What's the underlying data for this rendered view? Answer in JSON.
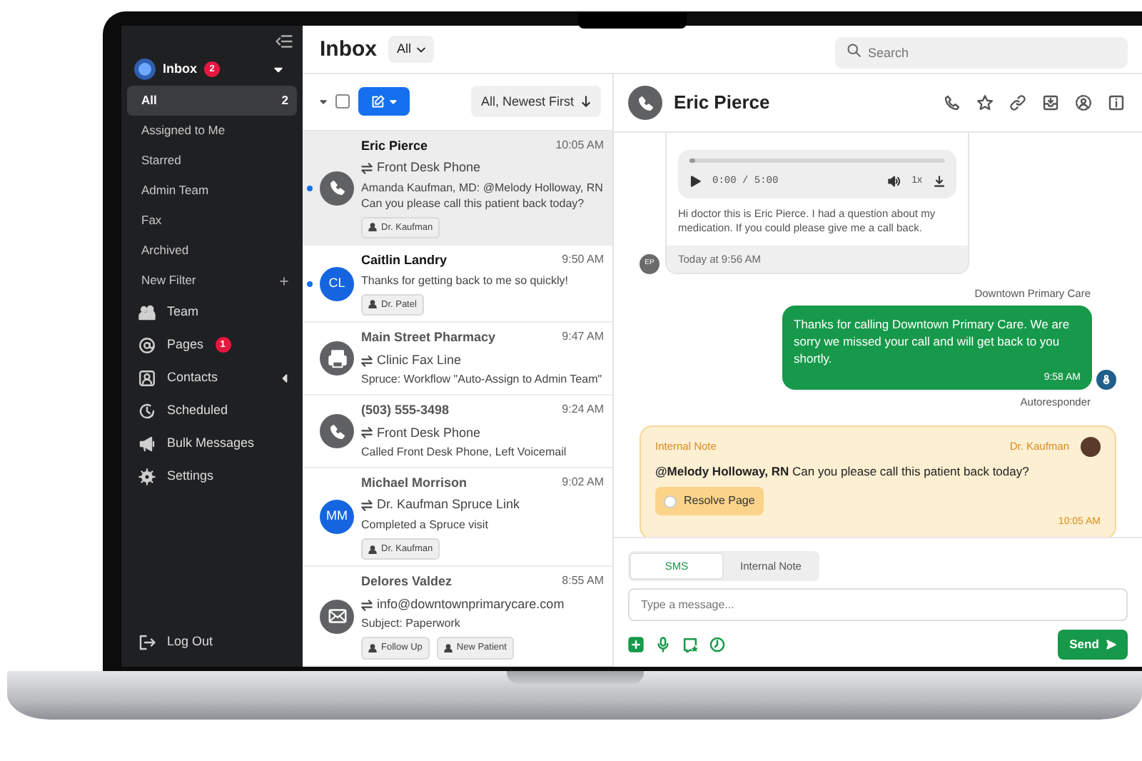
{
  "sidebar": {
    "inbox": {
      "label": "Inbox",
      "badge": "2",
      "expanded": true
    },
    "filters": [
      {
        "label": "All",
        "count": "2",
        "selected": true
      },
      {
        "label": "Assigned to Me",
        "selected": false
      },
      {
        "label": "Starred",
        "selected": false
      },
      {
        "label": "Admin Team",
        "selected": false
      },
      {
        "label": "Fax",
        "selected": false
      },
      {
        "label": "Archived",
        "selected": false
      }
    ],
    "new_filter": "New Filter",
    "nav": [
      {
        "kind": "team",
        "label": "Team"
      },
      {
        "kind": "pages",
        "label": "Pages",
        "badge": "1"
      },
      {
        "kind": "contacts",
        "label": "Contacts",
        "expanded": false
      },
      {
        "kind": "scheduled",
        "label": "Scheduled"
      },
      {
        "kind": "bulk",
        "label": "Bulk Messages"
      },
      {
        "kind": "settings",
        "label": "Settings"
      }
    ],
    "logout": "Log Out"
  },
  "header": {
    "title": "Inbox",
    "filter": "All",
    "search": {
      "placeholder": "Search"
    }
  },
  "list": {
    "select_all": {
      "checked": false
    },
    "sort": "All, Newest First",
    "conversations": [
      {
        "name": "Eric Pierce",
        "time": "10:05 AM",
        "unread": true,
        "selected": true,
        "avatar": {
          "kind": "phone"
        },
        "channel": "Front Desk Phone",
        "preview": "Amanda Kaufman, MD: @Melody Holloway, RN Can you please call this patient back today?",
        "tags": [
          "Dr. Kaufman"
        ]
      },
      {
        "name": "Caitlin Landry",
        "time": "9:50 AM",
        "unread": true,
        "selected": false,
        "avatar": {
          "kind": "initials",
          "initials": "CL"
        },
        "preview": "Thanks for getting back to me so quickly!",
        "tags": [
          "Dr. Patel"
        ]
      },
      {
        "name": "Main Street Pharmacy",
        "time": "9:47 AM",
        "unread": false,
        "selected": false,
        "avatar": {
          "kind": "fax"
        },
        "channel": "Clinic Fax Line",
        "preview": "Spruce: Workflow \"Auto-Assign to Admin Team\""
      },
      {
        "name": "(503) 555-3498",
        "time": "9:24 AM",
        "unread": false,
        "selected": false,
        "avatar": {
          "kind": "phone"
        },
        "channel": "Front Desk Phone",
        "preview": "Called Front Desk Phone, Left Voicemail"
      },
      {
        "name": "Michael Morrison",
        "time": "9:02 AM",
        "unread": false,
        "selected": false,
        "avatar": {
          "kind": "initials",
          "initials": "MM"
        },
        "channel": "Dr. Kaufman Spruce Link",
        "preview": "Completed a Spruce visit",
        "tags": [
          "Dr. Kaufman"
        ]
      },
      {
        "name": "Delores Valdez",
        "time": "8:55 AM",
        "unread": false,
        "selected": false,
        "avatar": {
          "kind": "mail"
        },
        "channel": "info@downtownprimarycare.com",
        "preview": "Subject: Paperwork",
        "tags": [
          "Follow Up",
          "New Patient"
        ]
      }
    ]
  },
  "conversation": {
    "name": "Eric Pierce",
    "messages": [
      {
        "kind": "voicemail",
        "player_time": "0:00 / 5:00",
        "speed": "1x",
        "level": 0.0,
        "transcript": "Hi doctor this is Eric Pierce. I had a question about my medication. If you could please give me a call back.",
        "footer": "Today at 9:56 AM",
        "avatar": "EP"
      },
      {
        "kind": "sent",
        "sender": "Downtown Primary Care",
        "text": "Thanks for calling Downtown Primary Care. We are sorry we missed your call and will get back to you shortly.",
        "time": "9:58 AM",
        "footer": "Autoresponder"
      },
      {
        "kind": "note",
        "label": "Internal Note",
        "author": "Dr. Kaufman",
        "text": "**@Melody Holloway, RN** Can you please call this patient back today?",
        "action": "Resolve Page",
        "time": "10:05 AM"
      }
    ],
    "composer": {
      "tabs": [
        {
          "label": "SMS",
          "selected": true
        },
        {
          "label": "Internal Note",
          "selected": false
        }
      ],
      "placeholder": "Type a message...",
      "send": "Send"
    }
  }
}
